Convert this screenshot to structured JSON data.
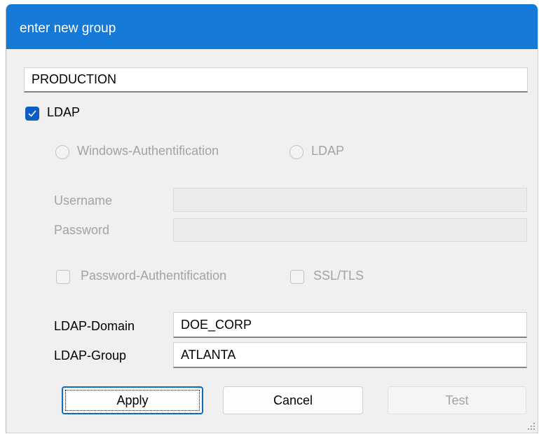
{
  "window": {
    "title": "enter new group"
  },
  "group_name": {
    "value": "PRODUCTION"
  },
  "ldap_checkbox": {
    "label": "LDAP",
    "checked": true
  },
  "auth_mode": {
    "options": [
      {
        "label": "Windows-Authentification",
        "selected": false
      },
      {
        "label": "LDAP",
        "selected": false
      }
    ]
  },
  "credentials": {
    "username_label": "Username",
    "username_value": "",
    "password_label": "Password",
    "password_value": ""
  },
  "options": {
    "password_auth_label": "Password-Authentification",
    "ssl_tls_label": "SSL/TLS"
  },
  "ldap": {
    "domain_label": "LDAP-Domain",
    "domain_value": "DOE_CORP",
    "group_label": "LDAP-Group",
    "group_value": "ATLANTA"
  },
  "buttons": {
    "apply": "Apply",
    "cancel": "Cancel",
    "test": "Test"
  },
  "colors": {
    "titlebar": "#1479d7",
    "checkbox_checked": "#0a5ec4",
    "disabled_text": "#a3a3a3"
  }
}
